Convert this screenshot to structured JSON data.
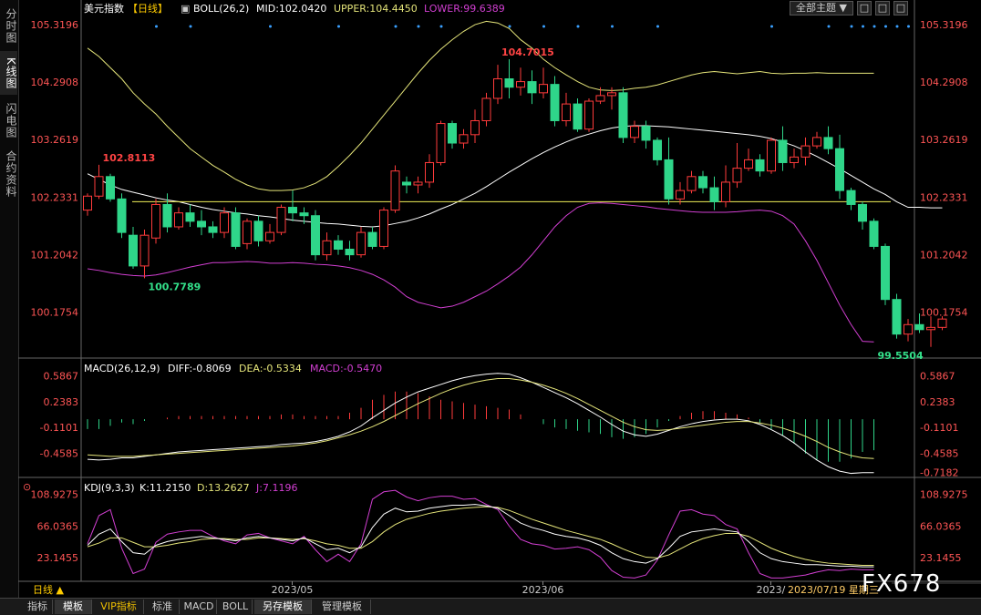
{
  "side_tabs": [
    "分时图",
    "K线图",
    "闪电图",
    "合约资料"
  ],
  "bottom_tabs": [
    "指标",
    "模板",
    "VIP指标",
    "标准",
    "MACD",
    "BOLL",
    "另存模板",
    "管理模板"
  ],
  "toolbar": {
    "theme_label": "全部主题",
    "btn1": "□",
    "btn2": "□",
    "btn3": "□"
  },
  "colors": {
    "up": "#ff3b3b",
    "down": "#2fd68a",
    "mid": "#ffffff",
    "upper": "#e5e57a",
    "lower": "#d23fd2",
    "hline": "#f0f05a",
    "dea": "#e5e57a",
    "macd": "#d23fd2"
  },
  "chart_data": [
    {
      "type": "candlestick",
      "title": "美元指数",
      "period_tag": "【日线】",
      "legend": {
        "indicator": "BOLL(26,2)",
        "mid": "MID:102.0420",
        "upper": "UPPER:104.4450",
        "lower": "LOWER:99.6389"
      },
      "y_ticks": [
        105.3196,
        104.2908,
        103.2619,
        102.2331,
        101.2042,
        100.1754
      ],
      "y_tick_labels": [
        "105.3196",
        "104.2908",
        "103.2619",
        "102.2331",
        "101.2042",
        "100.1754"
      ],
      "ylim": [
        99.4,
        105.5
      ],
      "horizontal_line": 102.15,
      "annotations": [
        {
          "i": 1,
          "value": 102.8113,
          "label": "102.8113",
          "kind": "high"
        },
        {
          "i": 5,
          "value": 100.7789,
          "label": "100.7789",
          "kind": "low"
        },
        {
          "i": 36,
          "value": 104.7015,
          "label": "104.7015",
          "kind": "high"
        },
        {
          "i": 69,
          "value": 99.5504,
          "label": "99.5504",
          "kind": "low"
        }
      ],
      "x_labels": [
        {
          "i": 17,
          "label": "2023/05"
        },
        {
          "i": 39,
          "label": "2023/06"
        },
        {
          "i": 59,
          "label": "2023/"
        }
      ],
      "cursor_label": "2023/07/19 星期三",
      "event_dot_indices": [
        3,
        6,
        13,
        19,
        24,
        26,
        28,
        34,
        37,
        40,
        43,
        47,
        57,
        62,
        64,
        65,
        66,
        67,
        68,
        69
      ],
      "candles": [
        [
          102.0,
          102.25,
          101.9,
          102.3
        ],
        [
          102.25,
          102.6,
          102.2,
          102.81
        ],
        [
          102.6,
          102.2,
          102.15,
          102.65
        ],
        [
          102.2,
          101.6,
          101.5,
          102.3
        ],
        [
          101.55,
          101.0,
          100.95,
          101.7
        ],
        [
          101.0,
          101.55,
          100.78,
          101.65
        ],
        [
          101.5,
          102.1,
          101.4,
          102.2
        ],
        [
          102.1,
          101.7,
          101.6,
          102.3
        ],
        [
          101.7,
          101.95,
          101.65,
          102.05
        ],
        [
          101.95,
          101.8,
          101.7,
          102.1
        ],
        [
          101.8,
          101.7,
          101.55,
          102.0
        ],
        [
          101.7,
          101.6,
          101.5,
          101.8
        ],
        [
          101.6,
          101.95,
          101.5,
          102.05
        ],
        [
          101.95,
          101.35,
          101.3,
          102.05
        ],
        [
          101.4,
          101.8,
          101.3,
          101.85
        ],
        [
          101.8,
          101.45,
          101.35,
          101.9
        ],
        [
          101.45,
          101.6,
          101.4,
          101.75
        ],
        [
          101.6,
          102.05,
          101.55,
          102.1
        ],
        [
          102.05,
          101.95,
          101.8,
          102.35
        ],
        [
          101.95,
          101.9,
          101.75,
          102.05
        ],
        [
          101.9,
          101.2,
          101.1,
          102.0
        ],
        [
          101.2,
          101.45,
          101.1,
          101.6
        ],
        [
          101.45,
          101.3,
          101.2,
          101.55
        ],
        [
          101.3,
          101.2,
          101.1,
          101.45
        ],
        [
          101.2,
          101.6,
          101.15,
          101.7
        ],
        [
          101.6,
          101.35,
          101.3,
          101.7
        ],
        [
          101.35,
          102.0,
          101.3,
          102.05
        ],
        [
          102.0,
          102.7,
          101.95,
          102.8
        ],
        [
          102.5,
          102.45,
          102.3,
          102.6
        ],
        [
          102.45,
          102.5,
          102.3,
          102.6
        ],
        [
          102.5,
          102.85,
          102.4,
          103.0
        ],
        [
          102.85,
          103.55,
          102.8,
          103.6
        ],
        [
          103.55,
          103.2,
          103.1,
          103.6
        ],
        [
          103.2,
          103.35,
          103.1,
          103.45
        ],
        [
          103.35,
          103.6,
          103.2,
          103.8
        ],
        [
          103.6,
          104.0,
          103.5,
          104.1
        ],
        [
          104.0,
          104.35,
          103.9,
          104.6
        ],
        [
          104.35,
          104.2,
          104.0,
          104.7
        ],
        [
          104.2,
          104.3,
          104.05,
          104.55
        ],
        [
          104.3,
          104.1,
          103.9,
          104.5
        ],
        [
          104.1,
          104.25,
          104.0,
          104.55
        ],
        [
          104.25,
          103.6,
          103.5,
          104.4
        ],
        [
          103.6,
          103.9,
          103.5,
          104.1
        ],
        [
          103.9,
          103.45,
          103.4,
          104.0
        ],
        [
          103.45,
          103.95,
          103.4,
          104.0
        ],
        [
          103.95,
          104.05,
          103.9,
          104.2
        ],
        [
          104.05,
          104.1,
          103.8,
          104.2
        ],
        [
          104.1,
          103.3,
          103.2,
          104.2
        ],
        [
          103.3,
          103.5,
          103.2,
          103.6
        ],
        [
          103.5,
          103.25,
          103.1,
          103.6
        ],
        [
          103.25,
          102.9,
          102.8,
          103.3
        ],
        [
          102.9,
          102.2,
          102.1,
          103.3
        ],
        [
          102.2,
          102.35,
          102.1,
          102.5
        ],
        [
          102.35,
          102.6,
          102.3,
          102.7
        ],
        [
          102.6,
          102.4,
          102.3,
          102.7
        ],
        [
          102.4,
          102.15,
          102.0,
          102.6
        ],
        [
          102.15,
          102.5,
          102.05,
          102.8
        ],
        [
          102.5,
          102.75,
          102.4,
          103.2
        ],
        [
          102.75,
          102.9,
          102.7,
          103.1
        ],
        [
          102.9,
          102.7,
          102.6,
          103.0
        ],
        [
          102.7,
          103.25,
          102.65,
          103.3
        ],
        [
          103.25,
          102.85,
          102.7,
          103.5
        ],
        [
          102.85,
          102.95,
          102.75,
          103.1
        ],
        [
          102.95,
          103.15,
          102.8,
          103.3
        ],
        [
          103.15,
          103.3,
          103.1,
          103.4
        ],
        [
          103.3,
          103.1,
          103.0,
          103.5
        ],
        [
          103.1,
          102.35,
          102.2,
          103.35
        ],
        [
          102.35,
          102.1,
          102.0,
          102.4
        ],
        [
          102.1,
          101.8,
          101.65,
          102.15
        ],
        [
          101.8,
          101.35,
          101.3,
          101.85
        ],
        [
          101.35,
          100.4,
          100.3,
          101.4
        ],
        [
          100.4,
          99.78,
          99.7,
          100.5
        ],
        [
          99.78,
          99.95,
          99.65,
          100.05
        ],
        [
          99.95,
          99.86,
          99.8,
          100.15
        ],
        [
          99.86,
          99.9,
          99.55,
          100.1
        ],
        [
          99.9,
          100.05,
          99.85,
          100.1
        ]
      ],
      "boll_mid": [
        102.65,
        102.55,
        102.45,
        102.37,
        102.32,
        102.27,
        102.22,
        102.18,
        102.15,
        102.1,
        102.05,
        102.01,
        101.98,
        101.95,
        101.93,
        101.9,
        101.88,
        101.85,
        101.82,
        101.8,
        101.78,
        101.76,
        101.75,
        101.73,
        101.71,
        101.7,
        101.72,
        101.76,
        101.8,
        101.86,
        101.93,
        102.02,
        102.1,
        102.2,
        102.3,
        102.42,
        102.55,
        102.68,
        102.8,
        102.92,
        103.03,
        103.13,
        103.22,
        103.3,
        103.36,
        103.42,
        103.47,
        103.5,
        103.51,
        103.51,
        103.5,
        103.49,
        103.47,
        103.45,
        103.43,
        103.41,
        103.39,
        103.37,
        103.35,
        103.32,
        103.28,
        103.22,
        103.15,
        103.06,
        102.96,
        102.85,
        102.74,
        102.62,
        102.5,
        102.38,
        102.28,
        102.15,
        102.05,
        102.05,
        102.04,
        102.04
      ],
      "boll_upper": [
        104.9,
        104.75,
        104.55,
        104.35,
        104.1,
        103.9,
        103.72,
        103.5,
        103.3,
        103.1,
        102.95,
        102.8,
        102.68,
        102.55,
        102.45,
        102.38,
        102.35,
        102.35,
        102.36,
        102.4,
        102.48,
        102.6,
        102.78,
        102.98,
        103.2,
        103.45,
        103.7,
        103.95,
        104.2,
        104.45,
        104.68,
        104.88,
        105.05,
        105.2,
        105.32,
        105.38,
        105.35,
        105.25,
        105.05,
        104.9,
        104.7,
        104.55,
        104.42,
        104.3,
        104.2,
        104.15,
        104.14,
        104.15,
        104.18,
        104.2,
        104.24,
        104.3,
        104.36,
        104.42,
        104.46,
        104.48,
        104.46,
        104.44,
        104.46,
        104.48,
        104.45,
        104.44,
        104.45,
        104.45,
        104.46,
        104.45,
        104.45,
        104.45,
        104.45,
        104.45
      ],
      "boll_lower": [
        100.95,
        100.92,
        100.88,
        100.85,
        100.83,
        100.82,
        100.84,
        100.88,
        100.93,
        100.98,
        101.02,
        101.06,
        101.06,
        101.07,
        101.08,
        101.07,
        101.05,
        101.05,
        101.06,
        101.05,
        101.03,
        101.02,
        101.0,
        100.97,
        100.92,
        100.85,
        100.75,
        100.62,
        100.45,
        100.35,
        100.3,
        100.25,
        100.28,
        100.35,
        100.45,
        100.55,
        100.68,
        100.82,
        100.98,
        101.2,
        101.45,
        101.7,
        101.9,
        102.05,
        102.12,
        102.13,
        102.12,
        102.1,
        102.08,
        102.06,
        102.03,
        102.01,
        101.99,
        101.97,
        101.96,
        101.96,
        101.96,
        101.97,
        101.99,
        102.0,
        101.98,
        101.9,
        101.75,
        101.45,
        101.1,
        100.7,
        100.3,
        99.95,
        99.65,
        99.64
      ]
    },
    {
      "type": "macd",
      "legend": {
        "indicator": "MACD(26,12,9)",
        "diff": "DIFF:-0.8069",
        "dea": "DEA:-0.5334",
        "macd": "MACD:-0.5470"
      },
      "y_ticks": [
        0.5867,
        0.2383,
        -0.1101,
        -0.4585
      ],
      "y_tick_labels": [
        "0.5867",
        "0.2383",
        "-0.1101",
        "-0.4585"
      ],
      "current_value_label": "-0.7182",
      "ylim": [
        -0.76,
        0.74
      ],
      "diff": [
        -0.54,
        -0.55,
        -0.54,
        -0.52,
        -0.52,
        -0.5,
        -0.48,
        -0.46,
        -0.44,
        -0.43,
        -0.42,
        -0.41,
        -0.4,
        -0.39,
        -0.38,
        -0.37,
        -0.36,
        -0.34,
        -0.33,
        -0.32,
        -0.3,
        -0.27,
        -0.23,
        -0.17,
        -0.09,
        0.02,
        0.12,
        0.22,
        0.3,
        0.37,
        0.42,
        0.47,
        0.52,
        0.56,
        0.59,
        0.61,
        0.62,
        0.61,
        0.56,
        0.5,
        0.43,
        0.36,
        0.29,
        0.21,
        0.12,
        0.03,
        -0.07,
        -0.16,
        -0.21,
        -0.23,
        -0.2,
        -0.15,
        -0.1,
        -0.06,
        -0.03,
        -0.01,
        0.0,
        0.0,
        -0.02,
        -0.07,
        -0.14,
        -0.22,
        -0.32,
        -0.44,
        -0.55,
        -0.64,
        -0.7,
        -0.73,
        -0.72,
        -0.72
      ],
      "dea": [
        -0.48,
        -0.49,
        -0.5,
        -0.5,
        -0.5,
        -0.49,
        -0.48,
        -0.47,
        -0.46,
        -0.45,
        -0.44,
        -0.43,
        -0.42,
        -0.41,
        -0.4,
        -0.39,
        -0.38,
        -0.37,
        -0.36,
        -0.34,
        -0.32,
        -0.29,
        -0.25,
        -0.21,
        -0.16,
        -0.1,
        -0.03,
        0.05,
        0.13,
        0.21,
        0.28,
        0.35,
        0.41,
        0.46,
        0.5,
        0.53,
        0.55,
        0.55,
        0.53,
        0.5,
        0.46,
        0.41,
        0.35,
        0.28,
        0.2,
        0.12,
        0.04,
        -0.04,
        -0.1,
        -0.14,
        -0.15,
        -0.14,
        -0.12,
        -0.1,
        -0.08,
        -0.06,
        -0.04,
        -0.03,
        -0.03,
        -0.05,
        -0.08,
        -0.12,
        -0.17,
        -0.23,
        -0.3,
        -0.38,
        -0.44,
        -0.49,
        -0.52,
        -0.53
      ],
      "macd": [
        -0.06,
        -0.06,
        -0.04,
        -0.02,
        -0.03,
        -0.01,
        0.0,
        0.01,
        0.02,
        0.02,
        0.02,
        0.02,
        0.02,
        0.02,
        0.02,
        0.02,
        0.02,
        0.03,
        0.03,
        0.02,
        0.02,
        0.02,
        0.02,
        0.04,
        0.07,
        0.12,
        0.15,
        0.17,
        0.17,
        0.16,
        0.14,
        0.12,
        0.11,
        0.1,
        0.09,
        0.08,
        0.07,
        0.06,
        0.03,
        0.0,
        -0.03,
        -0.05,
        -0.06,
        -0.07,
        -0.08,
        -0.09,
        -0.11,
        -0.12,
        -0.11,
        -0.09,
        -0.05,
        -0.01,
        0.02,
        0.04,
        0.05,
        0.05,
        0.04,
        0.03,
        0.01,
        -0.02,
        -0.06,
        -0.1,
        -0.15,
        -0.21,
        -0.25,
        -0.26,
        -0.26,
        -0.24,
        -0.2,
        -0.19
      ]
    },
    {
      "type": "kdj",
      "legend": {
        "indicator": "KDJ(9,3,3)",
        "k": "K:11.2150",
        "d": "D:13.2627",
        "j": "J:7.1196"
      },
      "y_ticks": [
        108.9275,
        66.0365,
        23.1455
      ],
      "y_tick_labels": [
        "108.9275",
        "66.0365",
        "23.1455"
      ],
      "ylim": [
        -6,
        124
      ],
      "k": [
        40,
        55,
        62,
        45,
        30,
        28,
        40,
        45,
        48,
        50,
        52,
        50,
        48,
        46,
        50,
        52,
        50,
        48,
        46,
        50,
        42,
        34,
        36,
        30,
        38,
        64,
        82,
        90,
        85,
        86,
        90,
        92,
        94,
        94,
        95,
        93,
        90,
        80,
        70,
        64,
        60,
        55,
        52,
        50,
        46,
        40,
        30,
        22,
        18,
        16,
        22,
        36,
        52,
        58,
        60,
        62,
        60,
        58,
        45,
        30,
        22,
        18,
        16,
        14,
        14,
        13,
        12,
        12,
        11,
        11
      ],
      "d": [
        38,
        43,
        50,
        50,
        44,
        38,
        38,
        40,
        43,
        45,
        48,
        49,
        49,
        48,
        48,
        50,
        50,
        49,
        48,
        49,
        46,
        42,
        40,
        36,
        36,
        45,
        58,
        68,
        75,
        79,
        83,
        86,
        88,
        90,
        91,
        92,
        91,
        87,
        81,
        75,
        70,
        65,
        60,
        56,
        52,
        48,
        42,
        35,
        29,
        24,
        23,
        27,
        35,
        43,
        49,
        53,
        56,
        56,
        52,
        44,
        36,
        30,
        25,
        21,
        18,
        16,
        15,
        14,
        13,
        13
      ],
      "j": [
        42,
        80,
        88,
        36,
        2,
        8,
        44,
        55,
        58,
        60,
        60,
        52,
        46,
        42,
        54,
        56,
        50,
        46,
        42,
        52,
        34,
        18,
        28,
        18,
        42,
        102,
        112,
        114,
        105,
        100,
        104,
        106,
        106,
        102,
        103,
        95,
        88,
        66,
        48,
        42,
        40,
        35,
        36,
        38,
        34,
        24,
        6,
        -3,
        -4,
        0,
        20,
        54,
        86,
        88,
        82,
        80,
        68,
        62,
        30,
        2,
        -4,
        -4,
        -2,
        0,
        4,
        7,
        6,
        8,
        7,
        7
      ]
    }
  ],
  "bottom_left_label": "日线 ▲",
  "watermark": "FX678"
}
